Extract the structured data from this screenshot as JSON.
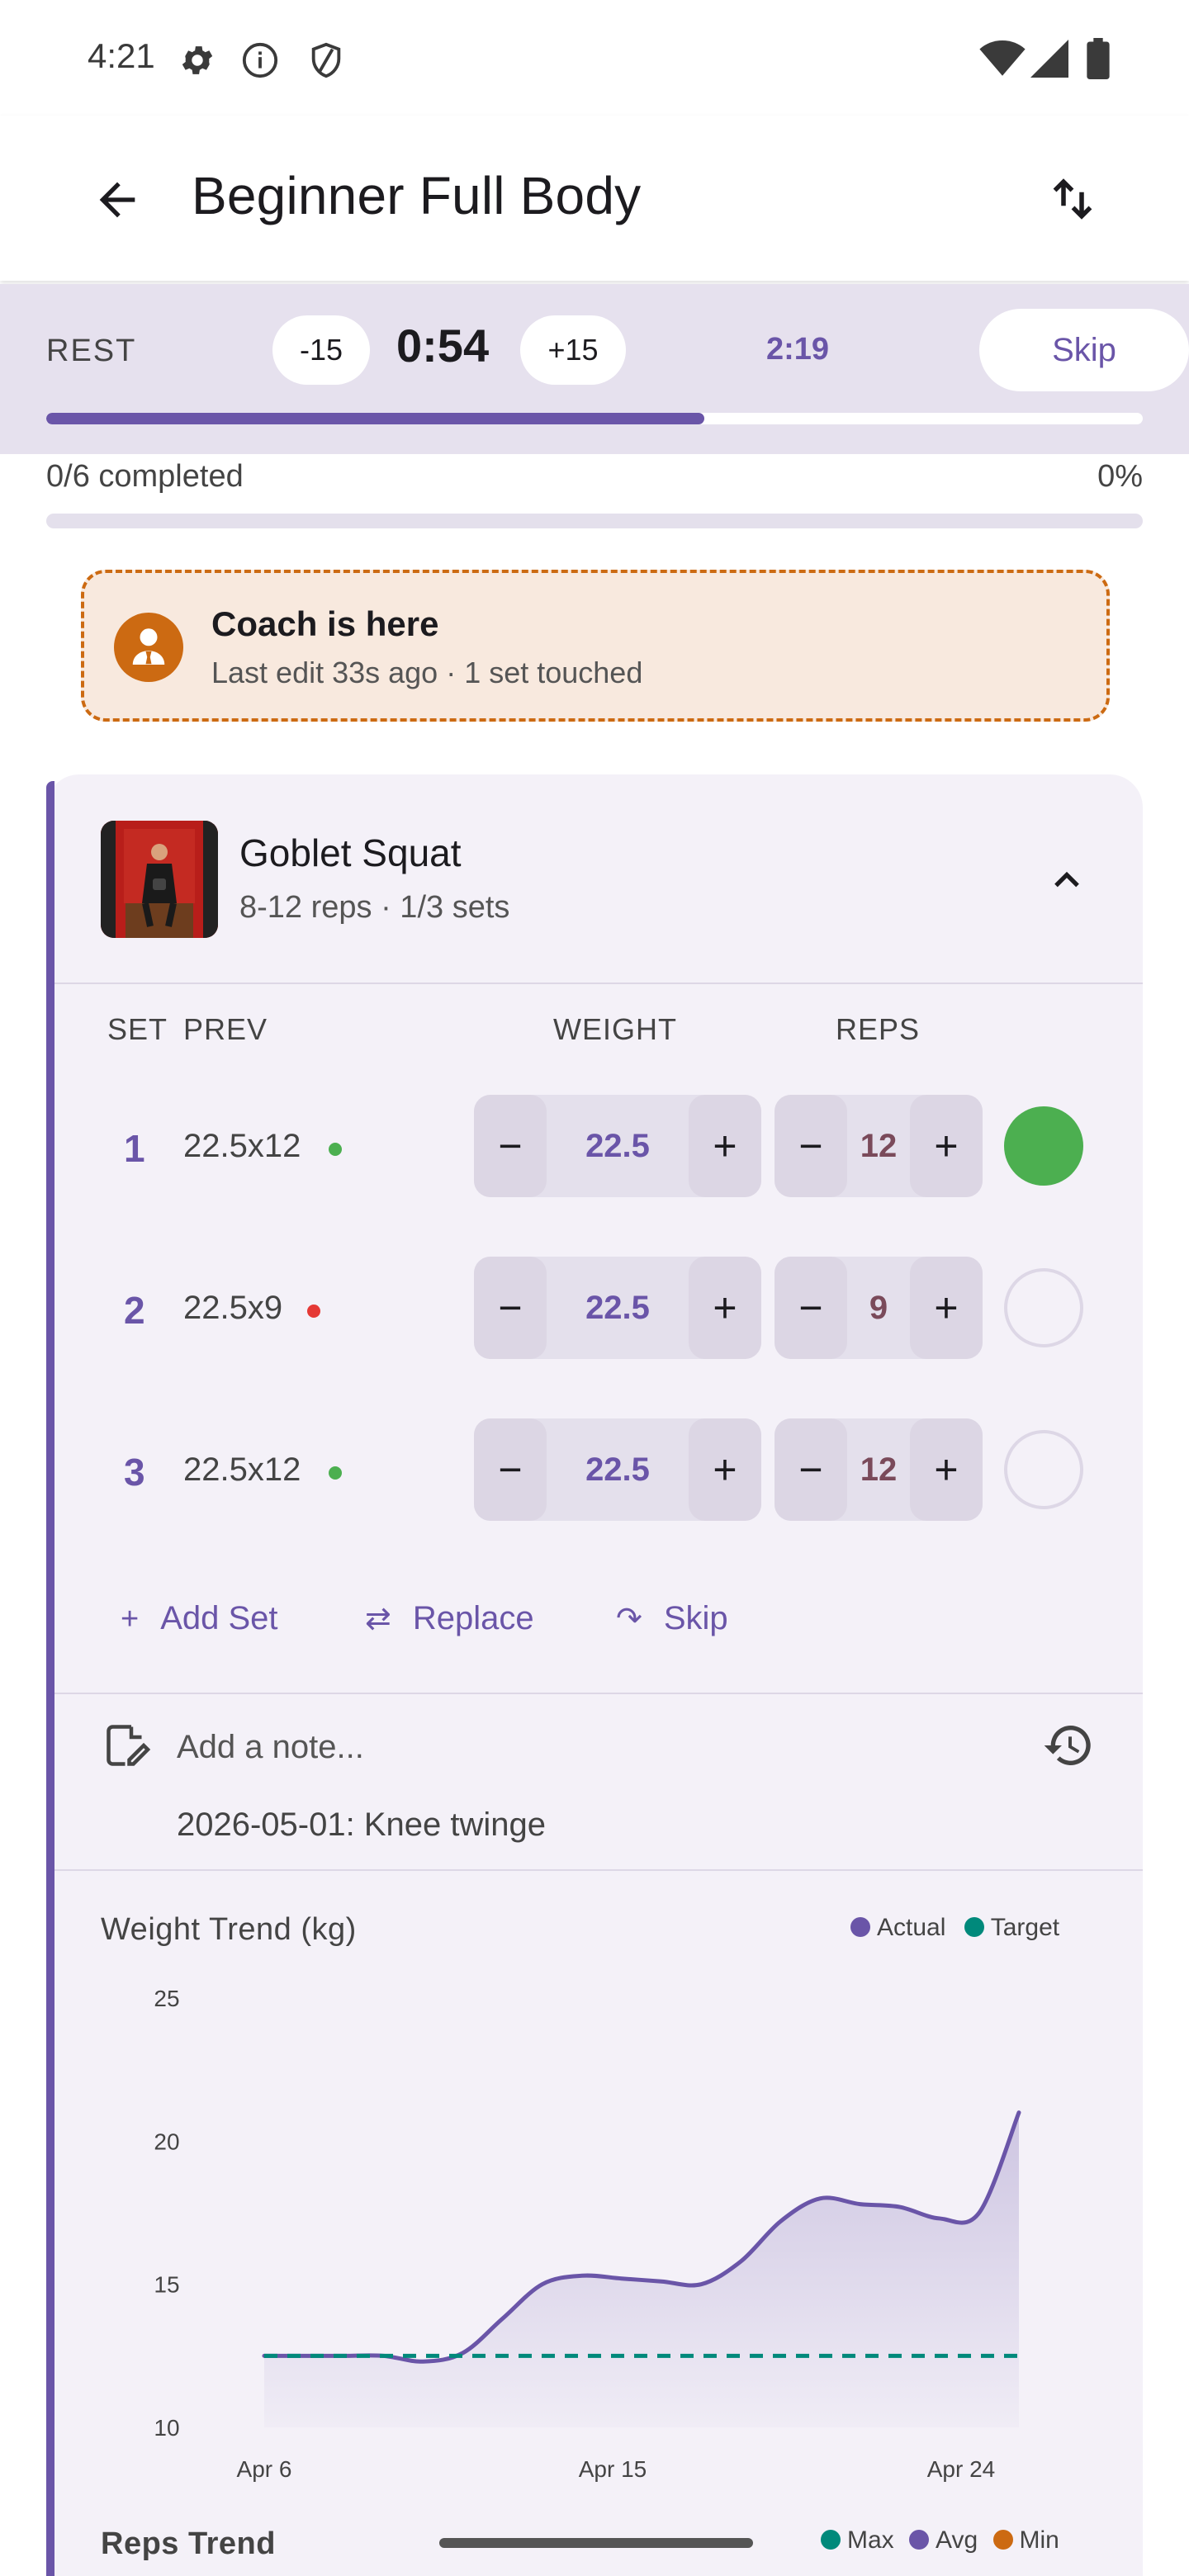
{
  "status_bar": {
    "time": "4:21"
  },
  "app_bar": {
    "title": "Beginner Full Body"
  },
  "rest_timer": {
    "label": "REST",
    "minus_label": "-15",
    "time": "0:54",
    "plus_label": "+15",
    "total": "2:19",
    "skip_label": "Skip",
    "progress": 0.6
  },
  "completion": {
    "label": "0/6 completed",
    "percent": "0%",
    "progress": 0.0
  },
  "coach": {
    "title": "Coach is here",
    "subtitle": "Last edit 33s ago · 1 set touched"
  },
  "exercise": {
    "name": "Goblet Squat",
    "meta": "8-12 reps · 1/3 sets",
    "columns": {
      "set": "SET",
      "prev": "PREV",
      "weight": "WEIGHT",
      "reps": "REPS"
    },
    "sets": [
      {
        "num": "1",
        "prev": "22.5x12",
        "prev_status": "#4caf50",
        "weight": "22.5",
        "reps": "12",
        "done": true
      },
      {
        "num": "2",
        "prev": "22.5x9",
        "prev_status": "#e53935",
        "weight": "22.5",
        "reps": "9",
        "done": false
      },
      {
        "num": "3",
        "prev": "22.5x12",
        "prev_status": "#4caf50",
        "weight": "22.5",
        "reps": "12",
        "done": false
      }
    ],
    "actions": {
      "add_set": "Add Set",
      "replace": "Replace",
      "skip": "Skip"
    },
    "note_placeholder": "Add a note...",
    "note_history": "2026-05-01: Knee twinge"
  },
  "weight_chart": {
    "title": "Weight Trend (kg)",
    "legend": [
      "Actual",
      "Target"
    ]
  },
  "reps_chart": {
    "title": "Reps Trend",
    "legend": [
      "Max",
      "Avg",
      "Min"
    ]
  },
  "colors": {
    "accent": "#6a55a8",
    "rest_bg": "#e6e1ee",
    "card_bg": "#f4f1f8",
    "coach_orange": "#cc6a12",
    "target_teal": "#00897b",
    "done_green": "#4caf50",
    "miss_red": "#e53935",
    "reps_text": "#7a4a5a"
  },
  "chart_data": {
    "type": "area",
    "title": "Weight Trend (kg)",
    "xlabel": "",
    "ylabel": "",
    "ylim": [
      10,
      25
    ],
    "yticks": [
      "10",
      "15",
      "20",
      "25"
    ],
    "xticks": [
      "Apr 6",
      "Apr 15",
      "Apr 24"
    ],
    "grid": false,
    "legend_position": "top-right",
    "series": [
      {
        "name": "Actual",
        "color": "#6a55a8",
        "x": [
          "Apr 6",
          "Apr 7",
          "Apr 8",
          "Apr 9",
          "Apr 10",
          "Apr 11",
          "Apr 12",
          "Apr 13",
          "Apr 14",
          "Apr 15",
          "Apr 16",
          "Apr 17",
          "Apr 18",
          "Apr 19",
          "Apr 20",
          "Apr 21",
          "Apr 22",
          "Apr 23",
          "Apr 24",
          "Apr 25"
        ],
        "values": [
          12.5,
          12.5,
          12.5,
          12.5,
          12.3,
          12.6,
          13.8,
          15.0,
          15.3,
          15.2,
          15.1,
          15.0,
          15.8,
          17.2,
          18.0,
          17.8,
          17.7,
          17.3,
          17.5,
          21.0
        ]
      },
      {
        "name": "Target",
        "color": "#00897b",
        "dashed": true,
        "x": [
          "Apr 6",
          "Apr 25"
        ],
        "values": [
          12.5,
          12.5
        ]
      }
    ]
  }
}
